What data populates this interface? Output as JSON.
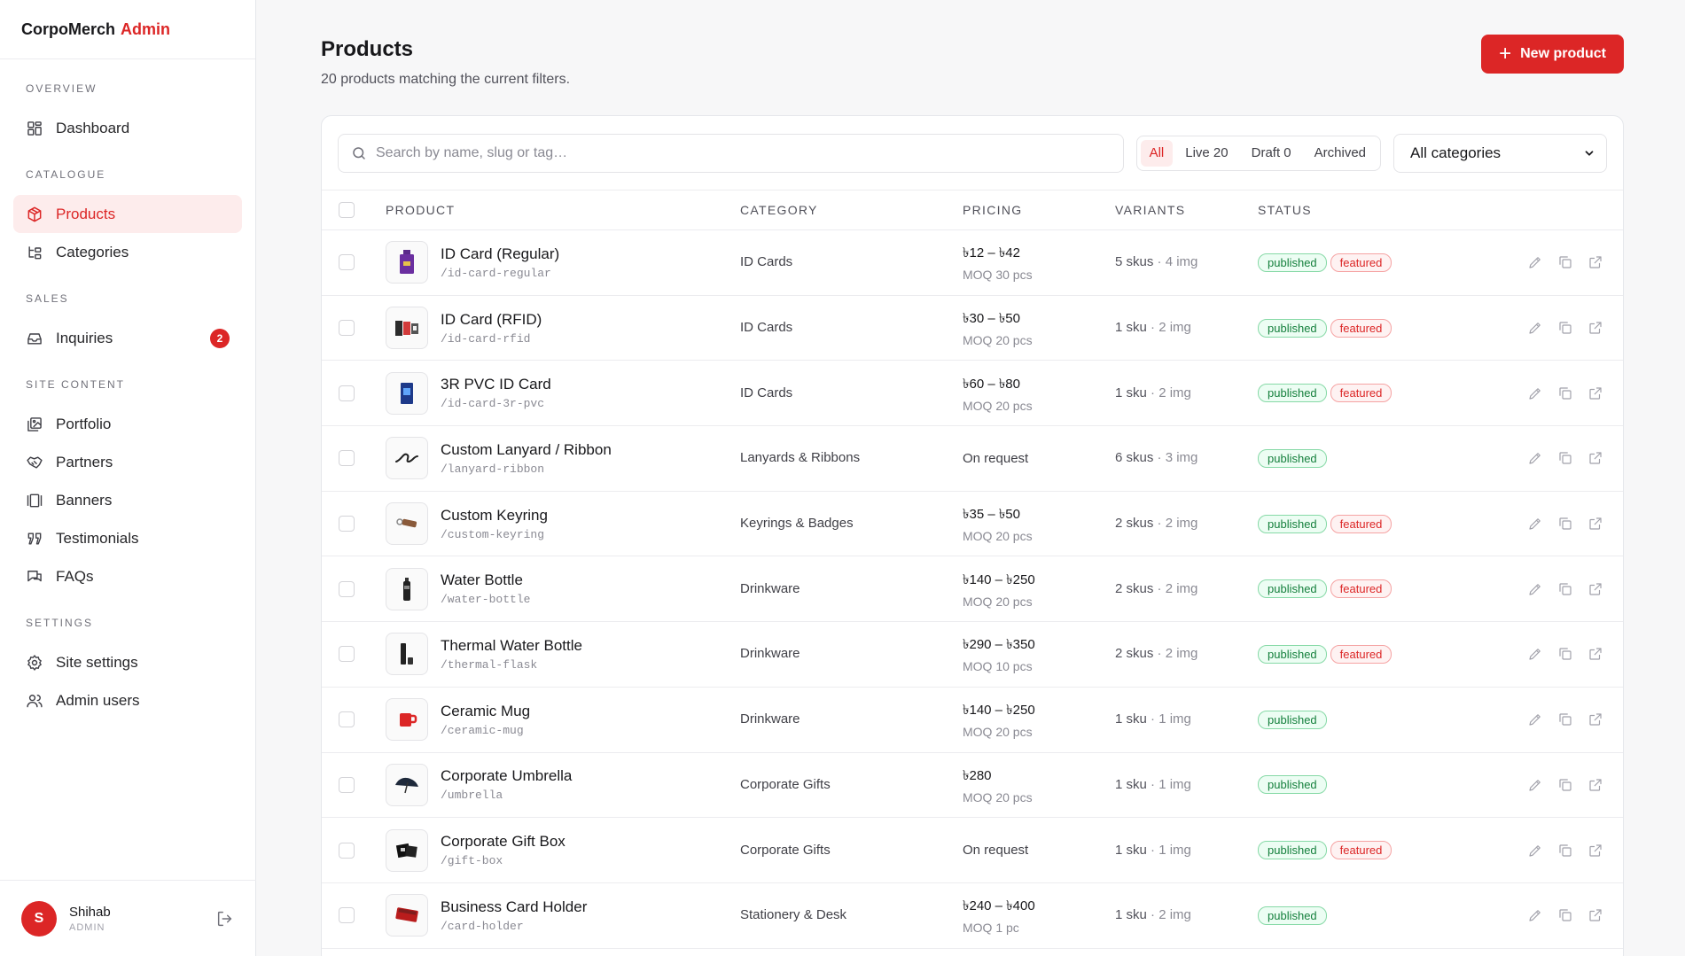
{
  "brand": {
    "name": "CorpoMerch",
    "accent": "Admin"
  },
  "sidebar": {
    "sections": [
      {
        "title": "OVERVIEW",
        "items": [
          {
            "label": "Dashboard",
            "icon": "dashboard-icon"
          }
        ]
      },
      {
        "title": "CATALOGUE",
        "items": [
          {
            "label": "Products",
            "icon": "box-icon",
            "active": true
          },
          {
            "label": "Categories",
            "icon": "categories-icon"
          }
        ]
      },
      {
        "title": "SALES",
        "items": [
          {
            "label": "Inquiries",
            "icon": "inbox-icon",
            "badge": "2"
          }
        ]
      },
      {
        "title": "SITE CONTENT",
        "items": [
          {
            "label": "Portfolio",
            "icon": "portfolio-icon"
          },
          {
            "label": "Partners",
            "icon": "handshake-icon"
          },
          {
            "label": "Banners",
            "icon": "banner-icon"
          },
          {
            "label": "Testimonials",
            "icon": "quote-icon"
          },
          {
            "label": "FAQs",
            "icon": "chat-icon"
          }
        ]
      },
      {
        "title": "SETTINGS",
        "items": [
          {
            "label": "Site settings",
            "icon": "gear-icon"
          },
          {
            "label": "Admin users",
            "icon": "users-icon"
          }
        ]
      }
    ]
  },
  "user": {
    "initial": "S",
    "name": "Shihab",
    "role": "ADMIN"
  },
  "header": {
    "title": "Products",
    "subtitle": "20 products matching the current filters.",
    "new_label": "New product"
  },
  "toolbar": {
    "search_placeholder": "Search by name, slug or tag…",
    "filters": [
      "All",
      "Live 20",
      "Draft 0",
      "Archived"
    ],
    "category_select": "All categories"
  },
  "table": {
    "headers": {
      "product": "PRODUCT",
      "category": "CATEGORY",
      "pricing": "PRICING",
      "variants": "VARIANTS",
      "status": "STATUS"
    },
    "rows": [
      {
        "name": "ID Card (Regular)",
        "slug": "/id-card-regular",
        "category": "ID Cards",
        "price": "৳12 – ৳42",
        "moq": "MOQ 30 pcs",
        "skus": "5 skus",
        "imgs": "4 img",
        "published": "published",
        "featured": "featured",
        "thumb": "id-card"
      },
      {
        "name": "ID Card (RFID)",
        "slug": "/id-card-rfid",
        "category": "ID Cards",
        "price": "৳30 – ৳50",
        "moq": "MOQ 20 pcs",
        "skus": "1 sku",
        "imgs": "2 img",
        "published": "published",
        "featured": "featured",
        "thumb": "rfid"
      },
      {
        "name": "3R PVC ID Card",
        "slug": "/id-card-3r-pvc",
        "category": "ID Cards",
        "price": "৳60 – ৳80",
        "moq": "MOQ 20 pcs",
        "skus": "1 sku",
        "imgs": "2 img",
        "published": "published",
        "featured": "featured",
        "thumb": "pvc"
      },
      {
        "name": "Custom Lanyard / Ribbon",
        "slug": "/lanyard-ribbon",
        "category": "Lanyards & Ribbons",
        "price": "On request",
        "moq": "",
        "skus": "6 skus",
        "imgs": "3 img",
        "published": "published",
        "featured": "",
        "thumb": "lanyard"
      },
      {
        "name": "Custom Keyring",
        "slug": "/custom-keyring",
        "category": "Keyrings & Badges",
        "price": "৳35 – ৳50",
        "moq": "MOQ 20 pcs",
        "skus": "2 skus",
        "imgs": "2 img",
        "published": "published",
        "featured": "featured",
        "thumb": "keyring"
      },
      {
        "name": "Water Bottle",
        "slug": "/water-bottle",
        "category": "Drinkware",
        "price": "৳140 – ৳250",
        "moq": "MOQ 20 pcs",
        "skus": "2 skus",
        "imgs": "2 img",
        "published": "published",
        "featured": "featured",
        "thumb": "bottle"
      },
      {
        "name": "Thermal Water Bottle",
        "slug": "/thermal-flask",
        "category": "Drinkware",
        "price": "৳290 – ৳350",
        "moq": "MOQ 10 pcs",
        "skus": "2 skus",
        "imgs": "2 img",
        "published": "published",
        "featured": "featured",
        "thumb": "flask"
      },
      {
        "name": "Ceramic Mug",
        "slug": "/ceramic-mug",
        "category": "Drinkware",
        "price": "৳140 – ৳250",
        "moq": "MOQ 20 pcs",
        "skus": "1 sku",
        "imgs": "1 img",
        "published": "published",
        "featured": "",
        "thumb": "mug"
      },
      {
        "name": "Corporate Umbrella",
        "slug": "/umbrella",
        "category": "Corporate Gifts",
        "price": "৳280",
        "moq": "MOQ 20 pcs",
        "skus": "1 sku",
        "imgs": "1 img",
        "published": "published",
        "featured": "",
        "thumb": "umbrella"
      },
      {
        "name": "Corporate Gift Box",
        "slug": "/gift-box",
        "category": "Corporate Gifts",
        "price": "On request",
        "moq": "",
        "skus": "1 sku",
        "imgs": "1 img",
        "published": "published",
        "featured": "featured",
        "thumb": "giftbox"
      },
      {
        "name": "Business Card Holder",
        "slug": "/card-holder",
        "category": "Stationery & Desk",
        "price": "৳240 – ৳400",
        "moq": "MOQ 1 pc",
        "skus": "1 sku",
        "imgs": "2 img",
        "published": "published",
        "featured": "",
        "thumb": "cardholder"
      }
    ]
  },
  "colors": {
    "accent": "#dc2626",
    "published": "#15803d",
    "featured": "#dc2626"
  }
}
